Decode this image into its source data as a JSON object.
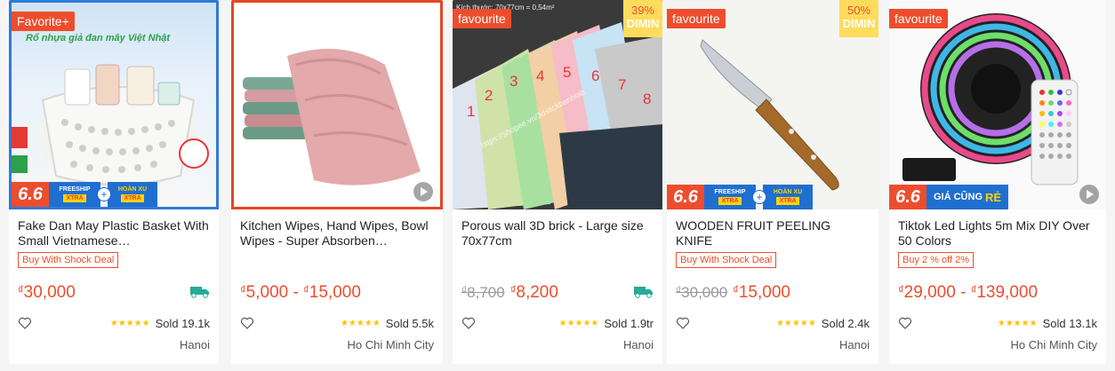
{
  "products": [
    {
      "badge": "Favorite+",
      "image_text": "Rổ nhựa giả đan mây Việt Nhật",
      "name": "Fake Dan May Plastic Basket With Small Vietnamese…",
      "deal": "Buy With Shock Deal",
      "price": "30,000",
      "currency": "₫",
      "sold": "Sold 19.1k",
      "location": "Hanoi",
      "promo": "6.6",
      "freeship": "FREESHIP",
      "freeship_pill": "XTRA",
      "hoanxu": "HOÀN XU",
      "hoanxu_pill": "XTRA"
    },
    {
      "name": "Kitchen Wipes, Hand Wipes, Bowl Wipes - Super Absorben…",
      "price": "5,000",
      "price_max": "15,000",
      "currency": "₫",
      "sold": "Sold 5.5k",
      "location": "Ho Chi Minh City"
    },
    {
      "badge": "favourite",
      "discount_pct": "39%",
      "discount_word": "DIMIN",
      "image_numbers": [
        "1",
        "2",
        "3",
        "4",
        "5",
        "6",
        "7",
        "8"
      ],
      "image_caption": "Kích thước: 70x77cm = 0,54m²",
      "image_watermark": "https://shopee.vn/3dstickbanhlab",
      "name": "Porous wall 3D brick - Large size 70x77cm",
      "old_price": "8,700",
      "price": "8,200",
      "currency": "₫",
      "sold": "Sold 1.9tr",
      "location": "Hanoi"
    },
    {
      "badge": "favourite",
      "discount_pct": "50%",
      "discount_word": "DIMIN",
      "name": "WOODEN FRUIT PEELING KNIFE",
      "deal": "Buy With Shock Deal",
      "old_price": "30,000",
      "price": "15,000",
      "currency": "₫",
      "sold": "Sold 2.4k",
      "location": "Hanoi",
      "promo": "6.6",
      "freeship": "FREESHIP",
      "freeship_pill": "XTRA",
      "hoanxu": "HOÀN XU",
      "hoanxu_pill": "XTRA"
    },
    {
      "badge": "favourite",
      "name": "Tiktok Led Lights 5m Mix DIY Over 50 Colors",
      "deal": "Buy 2 % off 2%",
      "price": "29,000",
      "price_max": "139,000",
      "currency": "₫",
      "sold": "Sold 13.1k",
      "location": "Ho Chi Minh City",
      "promo": "6.6",
      "promo_text": "GIÁ CŨNG",
      "promo_text_accent": "RẺ"
    }
  ],
  "colors": {
    "accent": "#ee4d2d",
    "star": "#ffc200",
    "blue": "#1f6fd1"
  },
  "icons": {
    "wishlist": "heart-outline-icon",
    "shipping": "free-shipping-truck-icon",
    "rating": "star-icon",
    "video": "play-icon"
  }
}
